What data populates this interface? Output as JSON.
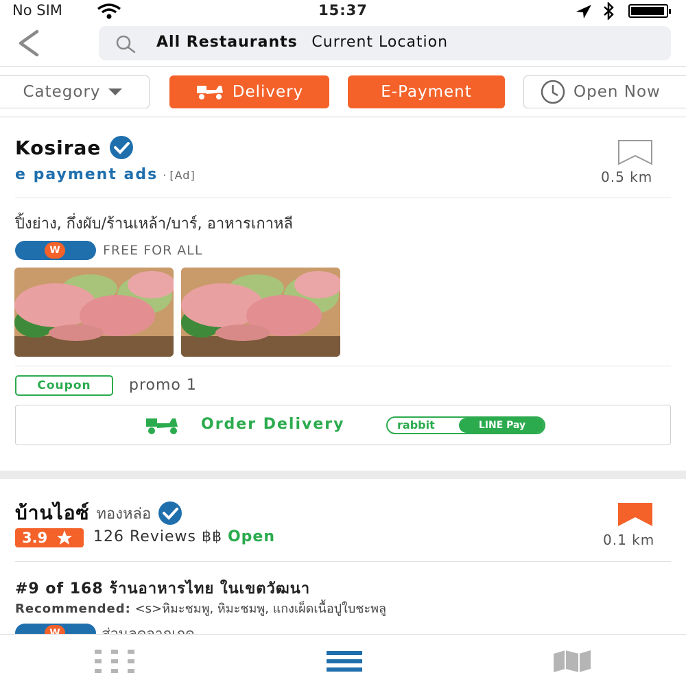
{
  "status_bar": {
    "carrier": "No SIM",
    "time": "15:37",
    "battery_level": 0.95
  },
  "search": {
    "query": "All Restaurants",
    "location": "Current Location"
  },
  "filters": [
    {
      "label": "Category",
      "style": "outline"
    },
    {
      "label": "Delivery",
      "style": "active"
    },
    {
      "label": "E-Payment",
      "style": "active"
    },
    {
      "label": "Open Now",
      "style": "outline"
    }
  ],
  "colors": {
    "accent": "#f4622a",
    "verified": "#1f6fad",
    "green": "#2bab4e"
  },
  "restaurants": [
    {
      "name": "Kosirae",
      "subtitle": "e payment ads",
      "ad_tag": "[Ad]",
      "distance": "0.5 km",
      "categories": "ปิ้งย่าง, กึ่งผับ/ร้านเหล้า/บาร์, อาหารเกาหลี",
      "w_badge": "W",
      "promo_text": "FREE FOR ALL",
      "coupon_label": "Coupon",
      "coupon_text": "promo 1",
      "order_label": "Order Delivery",
      "payment_rabbit": "rabbit",
      "payment_line": "LINE Pay",
      "bookmarked": false
    },
    {
      "name": "บ้านไอซ์",
      "branch": "ทองหล่อ",
      "rating": "3.9",
      "reviews": "126 Reviews",
      "price": "฿฿",
      "status": "Open",
      "distance": "0.1 km",
      "rank": "#9 of 168 ร้านอาหารไทย ในเขตวัฒนา",
      "recommended_label": "Recommended:",
      "recommended_items": "<s>หิมะชมพู, หิมะชมพู, แกงเผ็ดเนื้อปูใบชะพลู",
      "w_badge": "W",
      "partial_text": "ส่วนลดจากเกด",
      "bookmarked": true
    }
  ]
}
